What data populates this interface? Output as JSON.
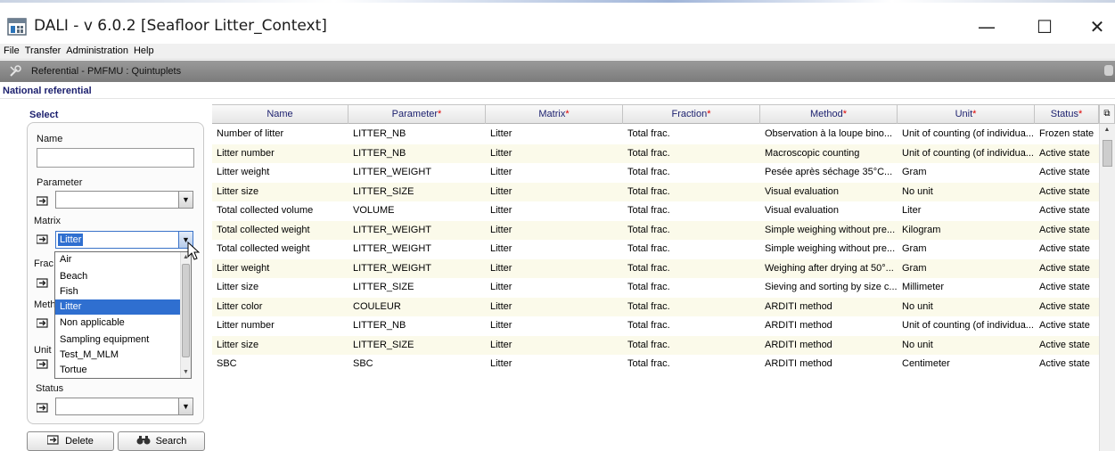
{
  "window": {
    "title": "DALI - v 6.0.2 [Seafloor Litter_Context]",
    "minimize": "—",
    "maximize": "☐",
    "close": "✕"
  },
  "menu": [
    "File",
    "Transfer",
    "Administration",
    "Help"
  ],
  "screen": {
    "title": "Referential - PMFMU : Quintuplets",
    "section": "National referential"
  },
  "select_panel": {
    "title": "Select",
    "name_label": "Name",
    "name_value": "",
    "parameter_label": "Parameter",
    "parameter_value": "",
    "matrix_label": "Matrix",
    "matrix_value": "Litter",
    "fraction_label": "Frac",
    "method_label": "Meth",
    "unit_label": "Unit",
    "status_label": "Status",
    "status_value": "",
    "matrix_options": [
      "Air",
      "Beach",
      "Fish",
      "Litter",
      "Non applicable",
      "Sampling equipment",
      "Test_M_MLM",
      "Tortue"
    ],
    "matrix_selected": "Litter",
    "delete_label": "Delete",
    "search_label": "Search"
  },
  "table": {
    "columns": [
      {
        "label": "Name",
        "required": false
      },
      {
        "label": "Parameter",
        "required": true
      },
      {
        "label": "Matrix",
        "required": true
      },
      {
        "label": "Fraction",
        "required": true
      },
      {
        "label": "Method",
        "required": true
      },
      {
        "label": "Unit",
        "required": true
      },
      {
        "label": "Status",
        "required": true
      }
    ],
    "required_mark": "*",
    "rows": [
      [
        "Number of litter",
        "LITTER_NB",
        "Litter",
        "Total frac.",
        "Observation à la loupe bino...",
        "Unit of counting (of individua...",
        "Frozen state"
      ],
      [
        "Litter number",
        "LITTER_NB",
        "Litter",
        "Total frac.",
        "Macroscopic counting",
        "Unit of counting (of individua...",
        "Active state"
      ],
      [
        "Litter weight",
        "LITTER_WEIGHT",
        "Litter",
        "Total frac.",
        "Pesée après séchage 35°C...",
        "Gram",
        "Active state"
      ],
      [
        "Litter size",
        "LITTER_SIZE",
        "Litter",
        "Total frac.",
        "Visual evaluation",
        "No unit",
        "Active state"
      ],
      [
        "Total collected volume",
        "VOLUME",
        "Litter",
        "Total frac.",
        "Visual evaluation",
        "Liter",
        "Active state"
      ],
      [
        "Total collected weight",
        "LITTER_WEIGHT",
        "Litter",
        "Total frac.",
        "Simple weighing without pre...",
        "Kilogram",
        "Active state"
      ],
      [
        "Total collected weight",
        "LITTER_WEIGHT",
        "Litter",
        "Total frac.",
        "Simple weighing without pre...",
        "Gram",
        "Active state"
      ],
      [
        "Litter weight",
        "LITTER_WEIGHT",
        "Litter",
        "Total frac.",
        "Weighing after drying at 50°...",
        "Gram",
        "Active state"
      ],
      [
        "Litter size",
        "LITTER_SIZE",
        "Litter",
        "Total frac.",
        "Sieving and sorting by size c...",
        "Millimeter",
        "Active state"
      ],
      [
        "Litter color",
        "COULEUR",
        "Litter",
        "Total frac.",
        "ARDITI method",
        "No unit",
        "Active state"
      ],
      [
        "Litter number",
        "LITTER_NB",
        "Litter",
        "Total frac.",
        "ARDITI method",
        "Unit of counting (of individua...",
        "Active state"
      ],
      [
        "Litter size",
        "LITTER_SIZE",
        "Litter",
        "Total frac.",
        "ARDITI method",
        "No unit",
        "Active state"
      ],
      [
        "SBC",
        "SBC",
        "Litter",
        "Total frac.",
        "ARDITI method",
        "Centimeter",
        "Active state"
      ]
    ]
  },
  "icons": {
    "app": "dali-app-icon",
    "tool": "tools-icon",
    "filter_arrow": "filter-arrow-icon",
    "delete": "delete-icon",
    "search": "binoculars-icon",
    "column_chooser": "column-chooser-icon"
  },
  "colors": {
    "header_text": "#1b1f6e",
    "required": "#dd0000",
    "selection": "#2f6fd0",
    "alt_row": "#fbfaea",
    "screen_bar": "#8a8a8a"
  }
}
